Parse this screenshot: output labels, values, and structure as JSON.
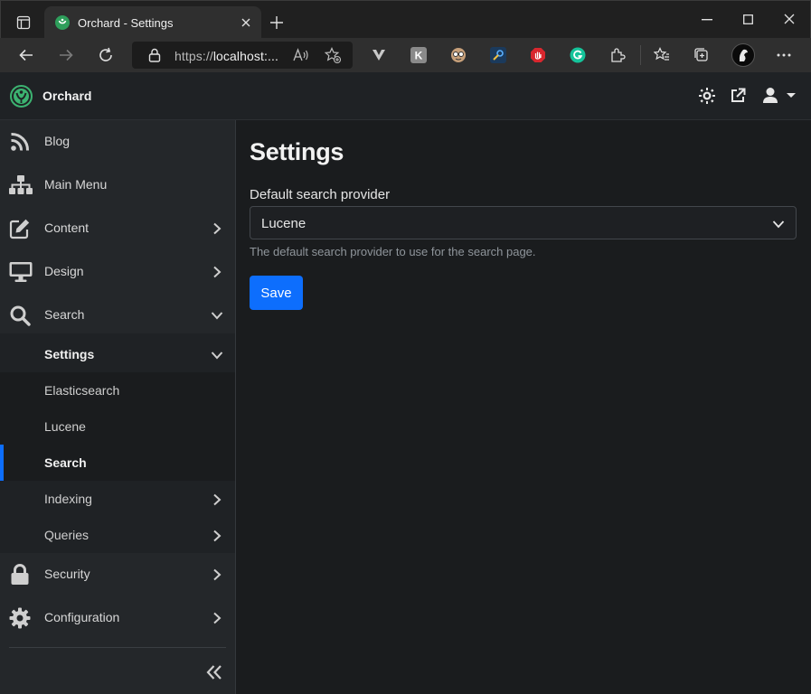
{
  "browser": {
    "tab_title": "Orchard - Settings",
    "url_prefix": "https://",
    "url_host": "localhost:...",
    "extension_k_label": "K"
  },
  "app": {
    "brand": "Orchard"
  },
  "sidebar": {
    "items": [
      {
        "label": "Blog",
        "icon": "rss-icon"
      },
      {
        "label": "Main Menu",
        "icon": "sitemap-icon"
      },
      {
        "label": "Content",
        "icon": "edit-icon"
      },
      {
        "label": "Design",
        "icon": "monitor-icon"
      },
      {
        "label": "Search",
        "icon": "search-icon"
      }
    ],
    "search_submenu": {
      "settings_label": "Settings",
      "settings_children": [
        "Elasticsearch",
        "Lucene",
        "Search"
      ],
      "active_child": "Search",
      "indexing_label": "Indexing",
      "queries_label": "Queries"
    },
    "bottom_items": [
      {
        "label": "Security",
        "icon": "lock-icon"
      },
      {
        "label": "Configuration",
        "icon": "gear-icon"
      }
    ]
  },
  "main": {
    "title": "Settings",
    "field_label": "Default search provider",
    "selected_provider": "Lucene",
    "hint": "The default search provider to use for the search page.",
    "save_label": "Save"
  },
  "colors": {
    "accent": "#0d6efd",
    "brand_green": "#3cb371"
  }
}
